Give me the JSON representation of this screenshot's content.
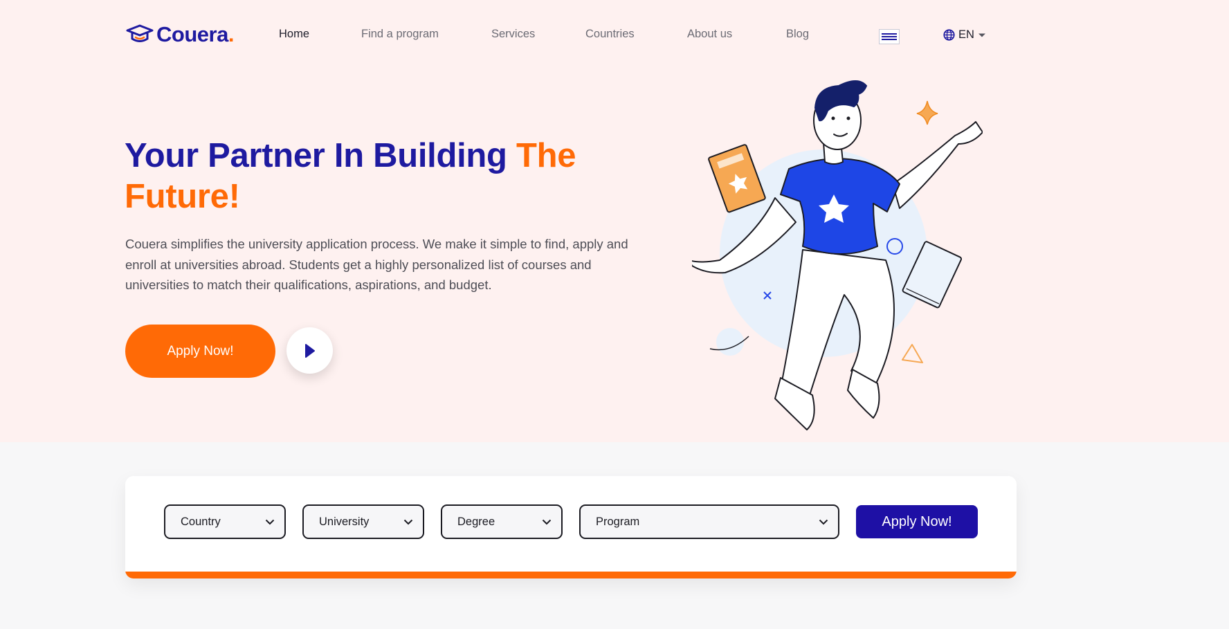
{
  "brand": {
    "name": "Couera",
    "dot": ".",
    "color_primary": "#1e1aa0",
    "color_accent": "#ff6a06"
  },
  "nav": {
    "items": [
      "Home",
      "Find a program",
      "Services",
      "Countries",
      "About us",
      "Blog"
    ],
    "active": "Home",
    "menu_icon": "hamburger-menu-icon",
    "language": {
      "icon": "globe-icon",
      "code": "EN",
      "caret": "caret-down-icon"
    }
  },
  "hero": {
    "headline_main": "Your Partner In Building",
    "headline_accent": "The Future!",
    "description": "Couera simplifies the university application process. We make it simple to find, apply and enroll at universities abroad. Students get a highly personalized list of courses and universities to match their qualifications, aspirations, and budget.",
    "cta_label": "Apply Now!",
    "play_icon": "play-icon"
  },
  "search": {
    "filters": [
      {
        "label": "Country",
        "icon": "chevron-down-icon"
      },
      {
        "label": "University",
        "icon": "chevron-down-icon"
      },
      {
        "label": "Degree",
        "icon": "chevron-down-icon"
      },
      {
        "label": "Program",
        "icon": "chevron-down-icon"
      }
    ],
    "apply_label": "Apply Now!"
  }
}
